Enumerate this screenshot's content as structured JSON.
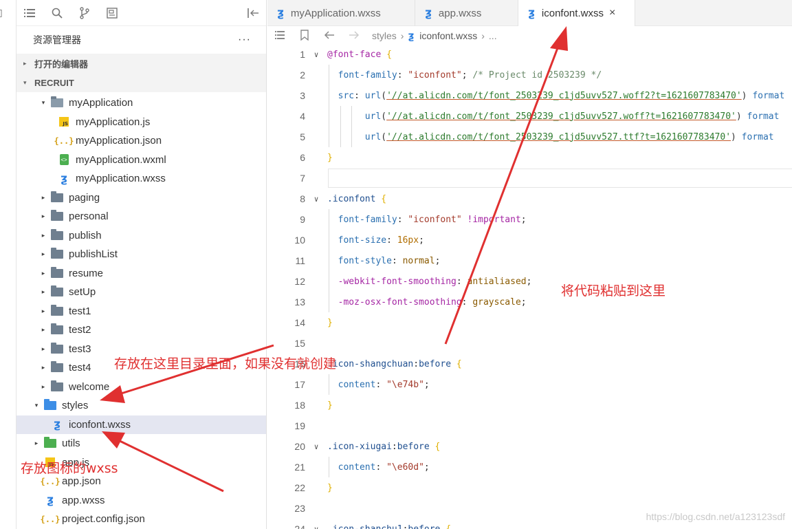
{
  "explorer": {
    "title": "资源管理器",
    "more": "···",
    "sections": [
      {
        "label": "打开的编辑器",
        "expanded": false
      },
      {
        "label": "RECRUIT",
        "expanded": true
      }
    ],
    "tree": [
      {
        "label": "myApplication",
        "type": "folder-open",
        "depth": 1,
        "twisty": "▾"
      },
      {
        "label": "myApplication.js",
        "type": "js",
        "depth": 2,
        "twisty": ""
      },
      {
        "label": "myApplication.json",
        "type": "json",
        "depth": 2,
        "twisty": ""
      },
      {
        "label": "myApplication.wxml",
        "type": "wxml",
        "depth": 2,
        "twisty": ""
      },
      {
        "label": "myApplication.wxss",
        "type": "css",
        "depth": 2,
        "twisty": ""
      },
      {
        "label": "paging",
        "type": "folder",
        "depth": 1,
        "twisty": "▸"
      },
      {
        "label": "personal",
        "type": "folder",
        "depth": 1,
        "twisty": "▸"
      },
      {
        "label": "publish",
        "type": "folder",
        "depth": 1,
        "twisty": "▸"
      },
      {
        "label": "publishList",
        "type": "folder",
        "depth": 1,
        "twisty": "▸"
      },
      {
        "label": "resume",
        "type": "folder",
        "depth": 1,
        "twisty": "▸"
      },
      {
        "label": "setUp",
        "type": "folder",
        "depth": 1,
        "twisty": "▸"
      },
      {
        "label": "test1",
        "type": "folder",
        "depth": 1,
        "twisty": "▸"
      },
      {
        "label": "test2",
        "type": "folder",
        "depth": 1,
        "twisty": "▸"
      },
      {
        "label": "test3",
        "type": "folder",
        "depth": 1,
        "twisty": "▸"
      },
      {
        "label": "test4",
        "type": "folder",
        "depth": 1,
        "twisty": "▸"
      },
      {
        "label": "welcome",
        "type": "folder",
        "depth": 1,
        "twisty": "▸"
      },
      {
        "label": "styles",
        "type": "folder-blue",
        "depth": 0,
        "twisty": "▾"
      },
      {
        "label": "iconfont.wxss",
        "type": "css",
        "depth": 1,
        "twisty": "",
        "selected": true
      },
      {
        "label": "utils",
        "type": "folder-green",
        "depth": 0,
        "twisty": "▸"
      },
      {
        "label": "app.js",
        "type": "js",
        "depth": 0,
        "twisty": ""
      },
      {
        "label": "app.json",
        "type": "json",
        "depth": 0,
        "twisty": ""
      },
      {
        "label": "app.wxss",
        "type": "css",
        "depth": 0,
        "twisty": ""
      },
      {
        "label": "project.config.json",
        "type": "json",
        "depth": 0,
        "twisty": ""
      }
    ]
  },
  "tabs": [
    {
      "label": "myApplication.wxss",
      "active": false
    },
    {
      "label": "app.wxss",
      "active": false
    },
    {
      "label": "iconfont.wxss",
      "active": true,
      "close": "×"
    }
  ],
  "breadcrumb": {
    "folder": "styles",
    "file": "iconfont.wxss",
    "tail": "..."
  },
  "code_lines": [
    {
      "n": "1",
      "fold": "∨",
      "html": "<span class='c-at'>@font-face</span> <span class='c-br'>{</span>"
    },
    {
      "n": "2",
      "fold": "",
      "html": "  <span class='c-prop'>font-family</span>: <span class='c-str'>\"iconfont\"</span>; <span class='c-cm'>/* Project id 2503239 */</span>"
    },
    {
      "n": "3",
      "fold": "",
      "html": "  <span class='c-prop'>src</span>: <span class='c-fn'>url</span>(<span class='c-url'>'//at.alicdn.com/t/font_2503239_c1jd5uvv527.woff2?t=1621607783470'</span>) <span class='c-fn'>format</span>"
    },
    {
      "n": "4",
      "fold": "",
      "html": "       <span class='c-fn'>url</span>(<span class='c-url'>'//at.alicdn.com/t/font_2503239_c1jd5uvv527.woff?t=1621607783470'</span>) <span class='c-fn'>format</span>"
    },
    {
      "n": "5",
      "fold": "",
      "html": "       <span class='c-fn'>url</span>(<span class='c-url'>'//at.alicdn.com/t/font_2503239_c1jd5uvv527.ttf?t=1621607783470'</span>) <span class='c-fn'>format</span>"
    },
    {
      "n": "6",
      "fold": "",
      "html": "<span class='c-br'>}</span>"
    },
    {
      "n": "7",
      "fold": "",
      "html": ""
    },
    {
      "n": "8",
      "fold": "∨",
      "html": "<span class='c-sel'>.iconfont</span> <span class='c-br'>{</span>"
    },
    {
      "n": "9",
      "fold": "",
      "html": "  <span class='c-prop'>font-family</span>: <span class='c-str'>\"iconfont\"</span> <span class='c-vend'>!important</span>;"
    },
    {
      "n": "10",
      "fold": "",
      "html": "  <span class='c-prop'>font-size</span>: <span class='c-num'>16px</span>;"
    },
    {
      "n": "11",
      "fold": "",
      "html": "  <span class='c-prop'>font-style</span>: <span class='c-val'>normal</span>;"
    },
    {
      "n": "12",
      "fold": "",
      "html": "  <span class='c-vend'>-webkit-font-smoothing</span>: <span class='c-val'>antialiased</span>;"
    },
    {
      "n": "13",
      "fold": "",
      "html": "  <span class='c-vend'>-moz-osx-font-smoothing</span>: <span class='c-val'>grayscale</span>;"
    },
    {
      "n": "14",
      "fold": "",
      "html": "<span class='c-br'>}</span>"
    },
    {
      "n": "15",
      "fold": "",
      "html": ""
    },
    {
      "n": "16",
      "fold": "",
      "html": "<span class='c-sel'>.icon-shangchuan</span>:<span class='c-sel'>before</span> <span class='c-br'>{</span>"
    },
    {
      "n": "17",
      "fold": "",
      "html": "  <span class='c-prop'>content</span>: <span class='c-str'>\"\\e74b\"</span>;"
    },
    {
      "n": "18",
      "fold": "",
      "html": "<span class='c-br'>}</span>"
    },
    {
      "n": "19",
      "fold": "",
      "html": ""
    },
    {
      "n": "20",
      "fold": "∨",
      "html": "<span class='c-sel'>.icon-xiugai</span>:<span class='c-sel'>before</span> <span class='c-br'>{</span>"
    },
    {
      "n": "21",
      "fold": "",
      "html": "  <span class='c-prop'>content</span>: <span class='c-str'>\"\\e60d\"</span>;"
    },
    {
      "n": "22",
      "fold": "",
      "html": "<span class='c-br'>}</span>"
    },
    {
      "n": "23",
      "fold": "",
      "html": ""
    },
    {
      "n": "24",
      "fold": "∨",
      "html": "<span class='c-sel'>.icon-shanchu1</span>:<span class='c-sel'>before</span> <span class='c-br'>{</span>"
    }
  ],
  "annotations": {
    "paste_here": "将代码粘贴到这里",
    "put_in_dir": "存放在这里目录里面，如果没有就创建",
    "icon_wxss": "存放图标的wxss"
  },
  "watermark": "https://blog.csdn.net/a123123sdf",
  "colors": {
    "accent": "#2b7fe0",
    "annotation": "#e03030",
    "selected_row": "#e4e6f1"
  },
  "icons": [
    "list-icon",
    "search-icon",
    "source-control-icon",
    "extensions-icon",
    "collapse-panel-icon",
    "bookmark-icon",
    "back-arrow-icon",
    "forward-arrow-icon"
  ]
}
